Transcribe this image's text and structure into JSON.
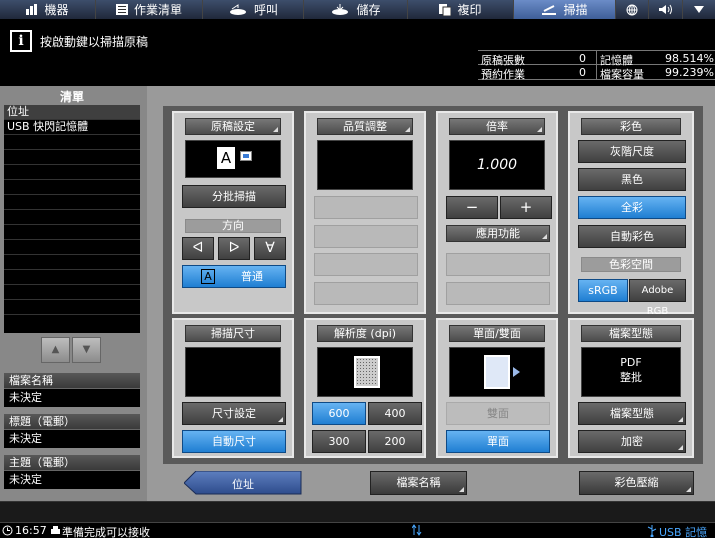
{
  "tabs": [
    {
      "label": "機器",
      "icon": "machine-icon"
    },
    {
      "label": "作業清單",
      "icon": "joblist-icon"
    },
    {
      "label": "呼叫",
      "icon": "recall-icon"
    },
    {
      "label": "儲存",
      "icon": "save-icon"
    },
    {
      "label": "複印",
      "icon": "copy-icon"
    },
    {
      "label": "掃描",
      "icon": "scan-icon",
      "active": true
    },
    {
      "label": "",
      "icon": "globe-icon"
    },
    {
      "label": "",
      "icon": "speaker-icon"
    },
    {
      "label": "",
      "icon": "chevron-down-icon"
    }
  ],
  "message": "按啟動鍵以掃描原稿",
  "counters": [
    {
      "label": "原稿張數",
      "value": "0",
      "label2": "記憶體",
      "value2": "98.514%"
    },
    {
      "label": "預約作業",
      "value": "0",
      "label2": "檔案容量",
      "value2": "99.239%"
    }
  ],
  "sidebar": {
    "title": "清單",
    "list_header": "位址",
    "items": [
      "USB 快閃記憶體"
    ],
    "fields": [
      {
        "label": "檔案名稱",
        "value": "未決定"
      },
      {
        "label": "標題（電郵）",
        "value": "未決定"
      },
      {
        "label": "主題（電郵）",
        "value": "未決定"
      }
    ]
  },
  "original": {
    "title": "原稿設定",
    "batch": "分批掃描",
    "direction": "方向",
    "normal": "普通",
    "orient_letter": "A"
  },
  "quality": {
    "title": "品質調整"
  },
  "zoom": {
    "title": "倍率",
    "value": "1.000",
    "minus": "−",
    "plus": "+",
    "app": "應用功能"
  },
  "color": {
    "title": "彩色",
    "options": [
      "灰階尺度",
      "黑色",
      "全彩",
      "自動彩色"
    ],
    "selected": "全彩",
    "space_title": "色彩空間",
    "srgb": "sRGB",
    "adobe": "Adobe RGB"
  },
  "scansize": {
    "title": "掃描尺寸",
    "setting": "尺寸設定",
    "auto": "自動尺寸"
  },
  "resolution": {
    "title": "解析度 (dpi)",
    "options": [
      "600",
      "400",
      "300",
      "200"
    ],
    "selected": "600"
  },
  "duplex": {
    "title": "單面/雙面",
    "double": "雙面",
    "single": "單面"
  },
  "filetype": {
    "title": "檔案型態",
    "line1": "PDF",
    "line2": "整批",
    "btn": "檔案型態",
    "encrypt": "加密"
  },
  "bottom": {
    "address": "位址",
    "filename": "檔案名稱",
    "compress": "彩色壓縮"
  },
  "status": {
    "time": "16:57",
    "text": "準備完成可以接收",
    "usb": "USB 記憶體"
  },
  "colors": {
    "selected": "#2a8ae0",
    "tab_active": "#5b7fc0"
  }
}
